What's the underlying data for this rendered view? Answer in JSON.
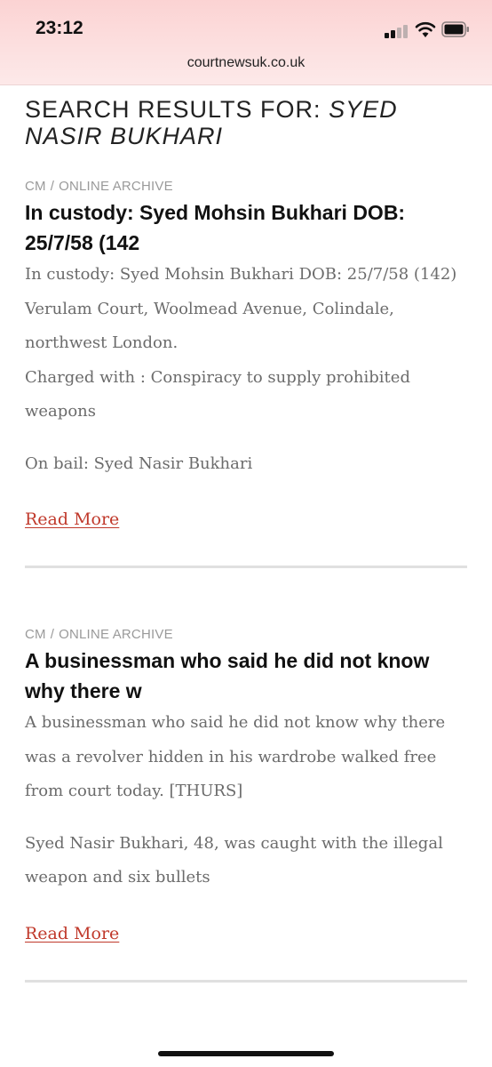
{
  "status_bar": {
    "time": "23:12",
    "url": "courtnewsuk.co.uk"
  },
  "search": {
    "prefix": "SEARCH RESULTS FOR:",
    "query": "SYED NASIR BUKHARI"
  },
  "results": [
    {
      "category": "CM",
      "separator": "/",
      "archive": "ONLINE ARCHIVE",
      "title": "In custody: Syed Mohsin Bukhari DOB: 25/7/58 (142",
      "paragraphs": [
        "In custody: Syed Mohsin Bukhari DOB: 25/7/58 (142) Verulam Court, Woolmead Avenue, Colindale, northwest London.",
        "Charged with : Conspiracy to supply prohibited weapons",
        "On bail: Syed Nasir Bukhari"
      ],
      "read_more": "Read More"
    },
    {
      "category": "CM",
      "separator": "/",
      "archive": "ONLINE ARCHIVE",
      "title": "A businessman who said he did not know why there w",
      "paragraphs": [
        "A businessman who said he did not know why there was a revolver hidden in his wardrobe walked free from court today. [THURS]",
        "Syed Nasir Bukhari, 48, was caught with the illegal weapon and six bullets"
      ],
      "read_more": "Read More"
    }
  ]
}
